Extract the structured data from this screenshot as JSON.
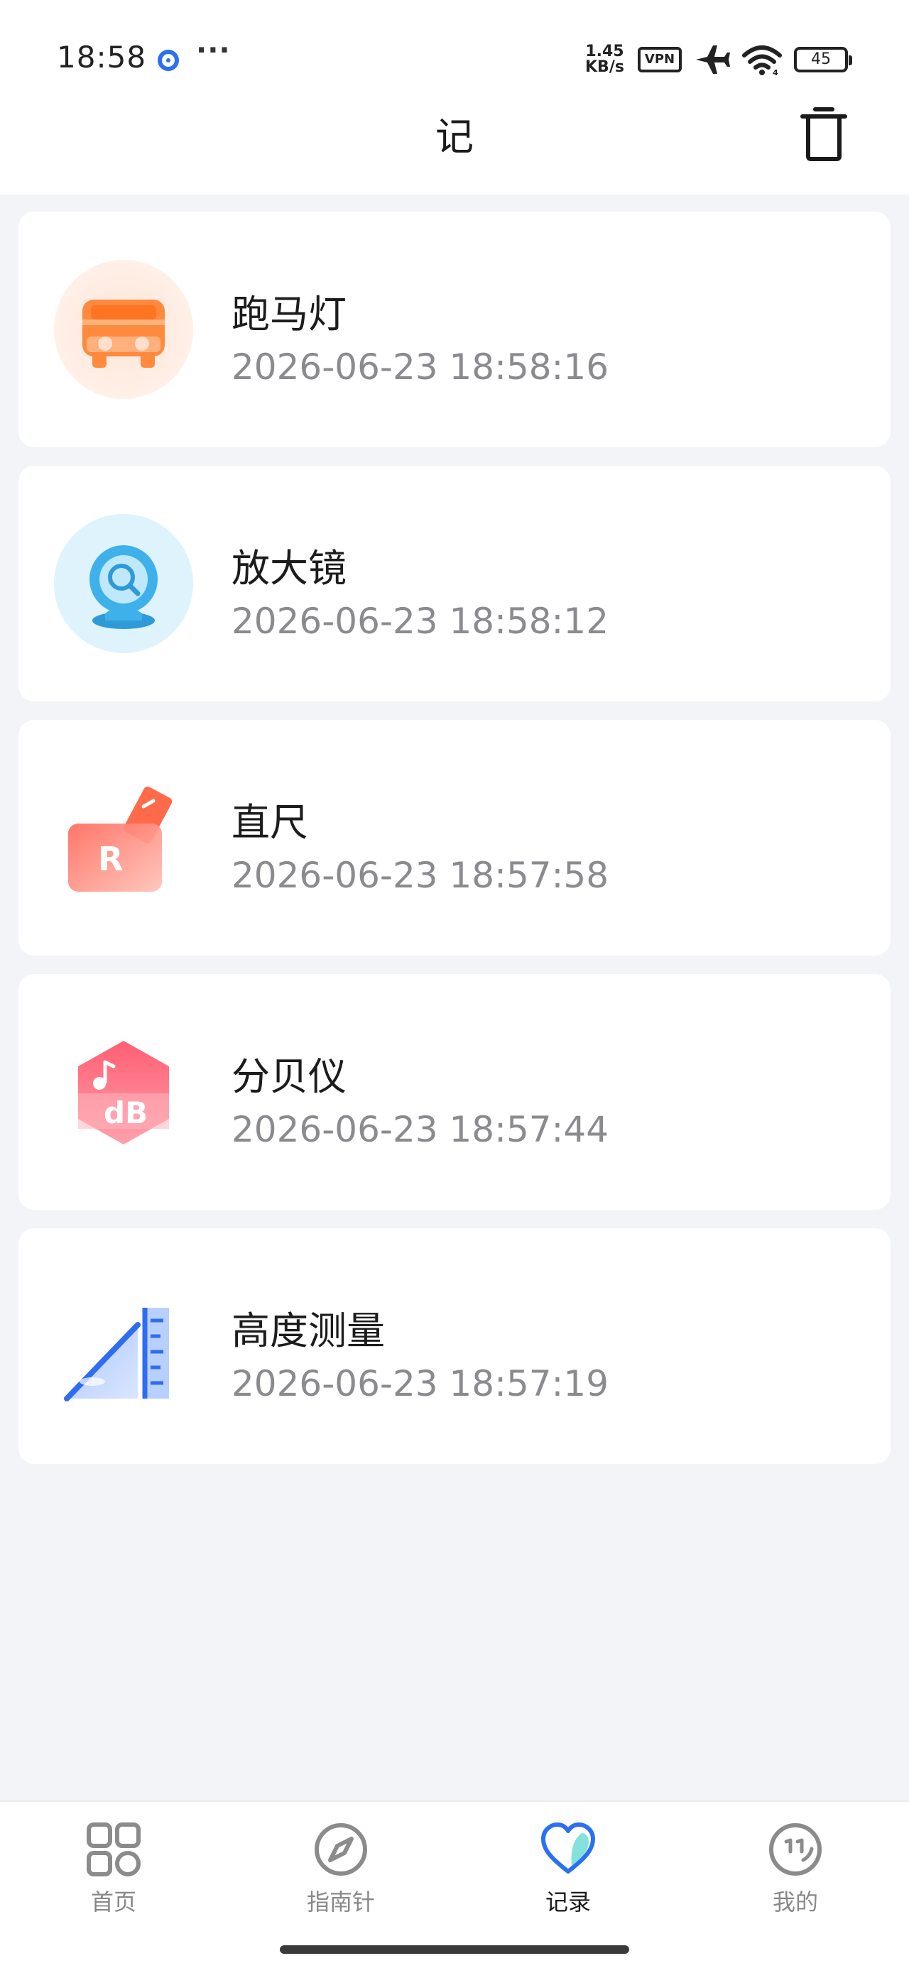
{
  "status_bar": {
    "time": "18:58",
    "more": "···",
    "net_speed_value": "1.45",
    "net_speed_unit": "KB/s",
    "vpn": "VPN",
    "battery": "45"
  },
  "header": {
    "title": "记"
  },
  "records": [
    {
      "title": "跑马灯",
      "time": "2026-06-23 18:58:16",
      "icon": "bus-icon"
    },
    {
      "title": "放大镜",
      "time": "2026-06-23 18:58:12",
      "icon": "magnifier-icon"
    },
    {
      "title": "直尺",
      "time": "2026-06-23 18:57:58",
      "icon": "ruler-icon"
    },
    {
      "title": "分贝仪",
      "time": "2026-06-23 18:57:44",
      "icon": "decibel-icon"
    },
    {
      "title": "高度测量",
      "time": "2026-06-23 18:57:19",
      "icon": "height-measure-icon"
    }
  ],
  "decibel_icon_text": "dB",
  "ruler_icon_text": "R",
  "nav": {
    "items": [
      {
        "label": "首页",
        "icon": "grid-icon"
      },
      {
        "label": "指南针",
        "icon": "compass-icon"
      },
      {
        "label": "记录",
        "icon": "heart-icon"
      },
      {
        "label": "我的",
        "icon": "smiley-icon"
      }
    ],
    "active_index": 2
  },
  "colors": {
    "accent": "#2b6ff2",
    "background": "#f3f4f7",
    "card": "#ffffff",
    "time_text": "#8a8a8f"
  }
}
